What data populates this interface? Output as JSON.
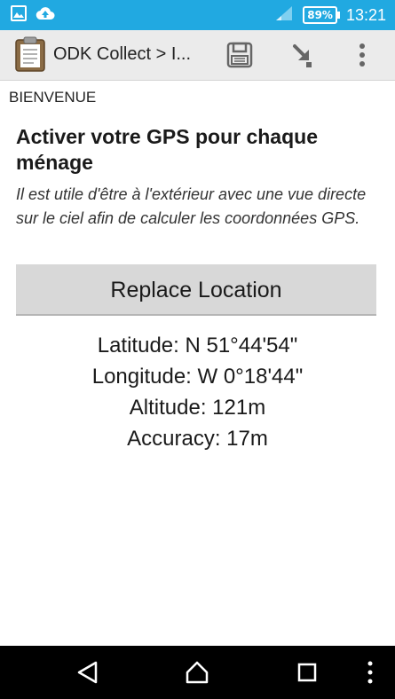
{
  "status_bar": {
    "battery_percent": "89%",
    "time": "13:21"
  },
  "action_bar": {
    "title": "ODK Collect > I..."
  },
  "form": {
    "group_label": "BIENVENUE",
    "question_title": "Activer votre GPS pour chaque ménage",
    "question_hint": "Il est utile d'être à l'extérieur avec une vue directe sur le ciel afin de calculer les coordonnées GPS.",
    "replace_button_label": "Replace Location",
    "gps": {
      "latitude": "Latitude: N 51°44'54\"",
      "longitude": "Longitude: W 0°18'44\"",
      "altitude": "Altitude: 121m",
      "accuracy": "Accuracy: 17m"
    }
  },
  "colors": {
    "status_bar": "#21a9e1",
    "action_bar": "#ebebeb",
    "button": "#d8d8d8",
    "nav_bar": "#000000"
  }
}
